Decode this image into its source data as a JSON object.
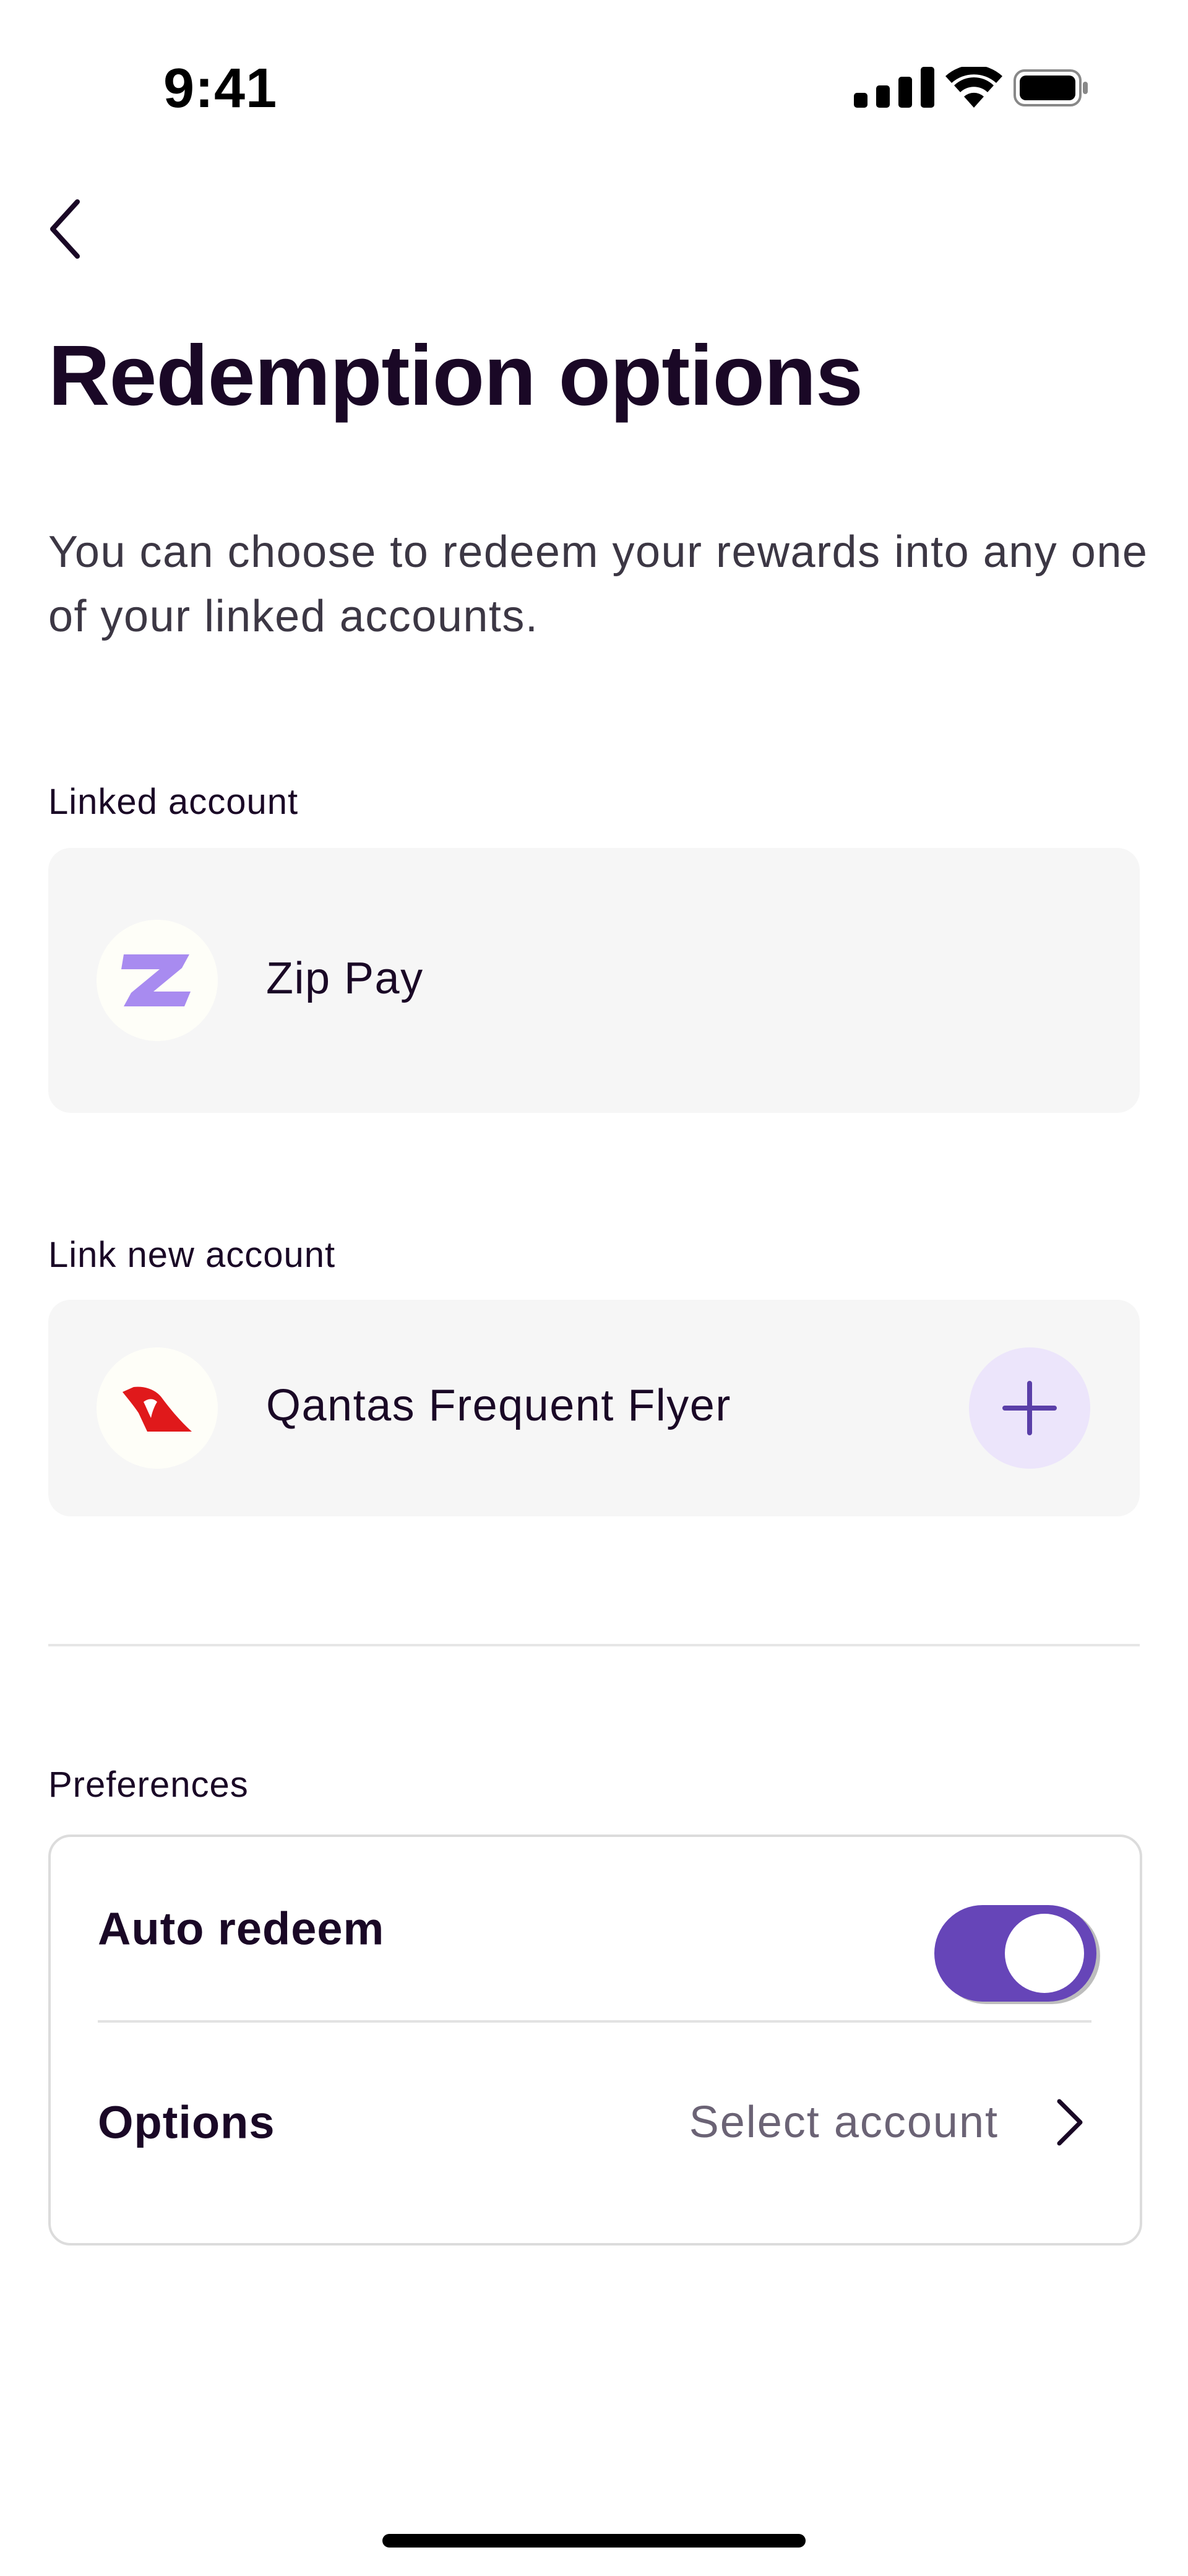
{
  "status_bar": {
    "time": "9:41",
    "icons": [
      "signal-icon",
      "wifi-icon",
      "battery-icon"
    ]
  },
  "header": {
    "back_icon": "chevron-left-icon",
    "title": "Redemption options"
  },
  "description": "You can choose to redeem your rewards into any one of your linked accounts.",
  "linked_section": {
    "label": "Linked account",
    "account": {
      "name": "Zip Pay",
      "logo": "zip-logo-icon",
      "logo_color": "#A88BF0"
    }
  },
  "link_new_section": {
    "label": "Link new account",
    "account": {
      "name": "Qantas Frequent Flyer",
      "logo": "qantas-logo-icon",
      "logo_color": "#E0191B",
      "action_icon": "plus-icon"
    }
  },
  "preferences": {
    "label": "Preferences",
    "auto_redeem": {
      "label": "Auto redeem",
      "enabled": true
    },
    "options": {
      "label": "Options",
      "value": "Select account",
      "icon": "chevron-right-icon"
    }
  },
  "colors": {
    "accent": "#6645B8",
    "accent_light": "#ECE5FB",
    "text_primary": "#1A0826",
    "card_background": "#F6F6F6"
  }
}
